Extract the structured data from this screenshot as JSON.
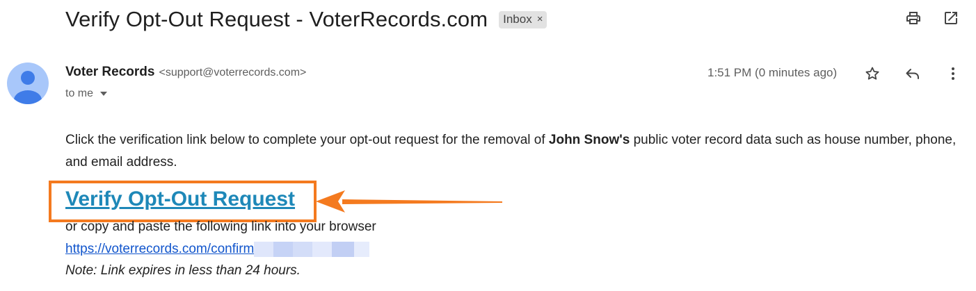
{
  "email": {
    "subject": "Verify Opt-Out Request - VoterRecords.com",
    "label_chip": "Inbox",
    "label_chip_remove": "×",
    "sender_name": "Voter Records",
    "sender_email": "<support@voterrecords.com>",
    "recipient": "to me",
    "timestamp": "1:51 PM (0 minutes ago)"
  },
  "toolbar_icons": [
    "print-icon",
    "open-in-new-window-icon",
    "star-icon",
    "reply-icon",
    "more-vert-icon"
  ],
  "body": {
    "intro_before": "Click the verification link below to complete your opt-out request for the removal of ",
    "intro_name": "John Snow's",
    "intro_after": " public voter record data such as house number, phone, and email address.",
    "verify_link": "Verify Opt-Out Request",
    "copy_instruction": "or copy and paste the following link into your browser",
    "confirm_url": "https://voterrecords.com/confirm",
    "note": "Note: Link expires in less than 24 hours."
  },
  "colors": {
    "annotation_orange": "#f47a1f",
    "verify_link_blue": "#1e88b8",
    "avatar_bg": "#a8c7fa",
    "avatar_fg": "#3f7ce8"
  }
}
